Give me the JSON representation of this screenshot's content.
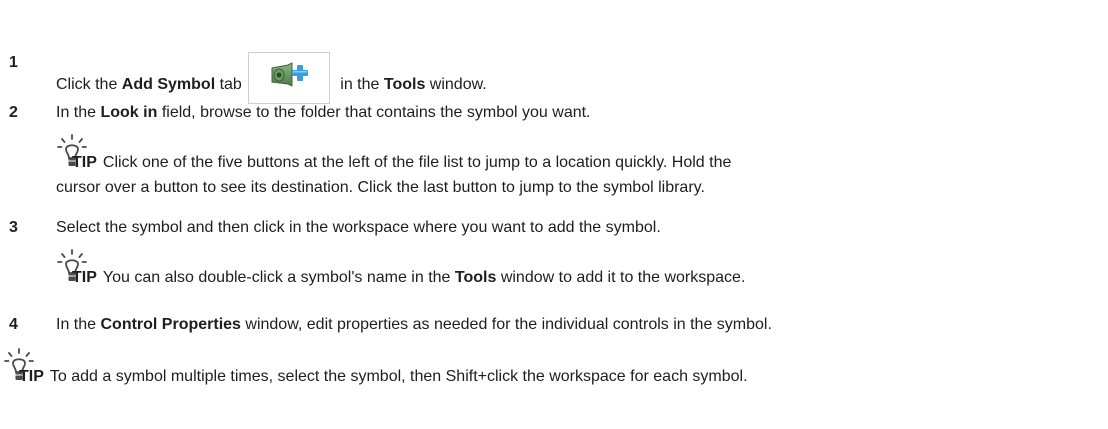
{
  "steps": [
    {
      "number": "1",
      "pre": "Click the ",
      "bold1": "Add Symbol",
      "mid": " tab",
      "post": " in the ",
      "bold2": "Tools",
      "tail": " window."
    },
    {
      "number": "2",
      "pre": "In the ",
      "bold1": "Look in",
      "post": " field, browse to the folder that contains the symbol you want."
    },
    {
      "number": "3",
      "text": "Select the symbol and then click in the workspace where you want to add the symbol."
    },
    {
      "number": "4",
      "pre": "In the ",
      "bold1": "Control Properties",
      "post": " window, edit properties as needed for the individual controls in the symbol."
    }
  ],
  "tips": [
    {
      "label": "TIP",
      "line1": "Click one of the five buttons at the left of the file list to jump to a location quickly. Hold the",
      "line2": "cursor over a button to see its destination. Click the last button to jump to the symbol library."
    },
    {
      "label": "TIP",
      "pre": "You can also double-click a symbol's name in the ",
      "bold1": "Tools",
      "post": " window to add it to the workspace."
    },
    {
      "label": "TIP",
      "text": "To add a symbol multiple times, select the symbol, then Shift+click the workspace for each symbol."
    }
  ],
  "icons": {
    "tab": "add-symbol-icon",
    "tip": "lightbulb-icon"
  },
  "colors": {
    "text": "#1e1e1e",
    "icon_green": "#5e8a53",
    "icon_plus": "#3a9de0"
  }
}
